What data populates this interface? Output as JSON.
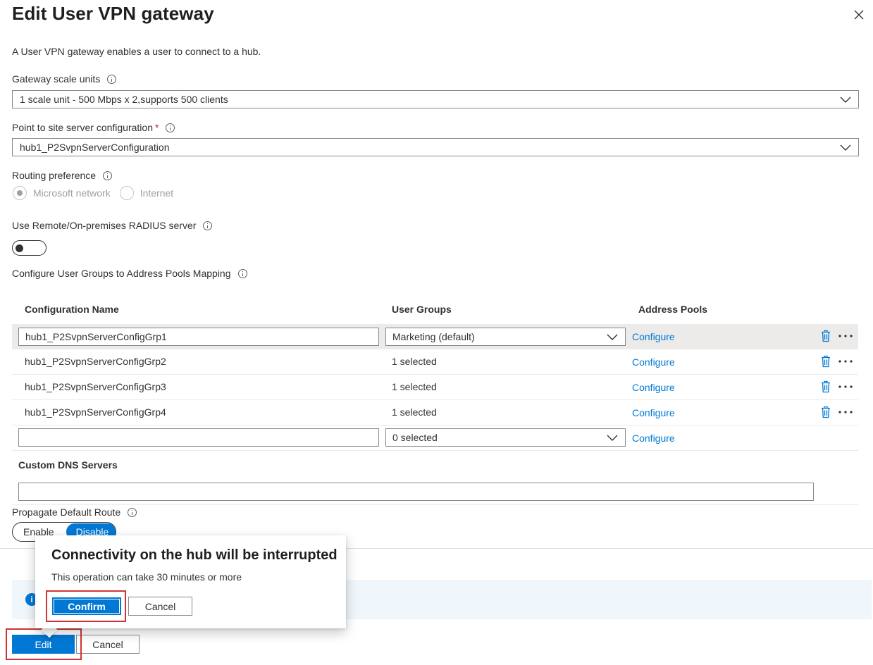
{
  "dialog": {
    "title": "Edit User VPN gateway",
    "description": "A User VPN gateway enables a user to connect to a hub."
  },
  "fields": {
    "gateway_scale_units": {
      "label": "Gateway scale units",
      "value": "1 scale unit - 500 Mbps x 2,supports 500 clients"
    },
    "p2s_config": {
      "label": "Point to site server configuration",
      "required_mark": "*",
      "value": "hub1_P2SvpnServerConfiguration"
    },
    "routing_preference": {
      "label": "Routing preference",
      "options": [
        "Microsoft network",
        "Internet"
      ],
      "selected": "Microsoft network"
    },
    "radius": {
      "label": "Use Remote/On-premises RADIUS server",
      "enabled": false
    },
    "mapping": {
      "label": "Configure User Groups to Address Pools Mapping"
    }
  },
  "table": {
    "headers": [
      "Configuration Name",
      "User Groups",
      "Address Pools"
    ],
    "rows": [
      {
        "name": "hub1_P2SvpnServerConfigGrp1",
        "groups": "Marketing (default)",
        "pools": "Configure"
      },
      {
        "name": "hub1_P2SvpnServerConfigGrp2",
        "groups": "1 selected",
        "pools": "Configure"
      },
      {
        "name": "hub1_P2SvpnServerConfigGrp3",
        "groups": "1 selected",
        "pools": "Configure"
      },
      {
        "name": "hub1_P2SvpnServerConfigGrp4",
        "groups": "1 selected",
        "pools": "Configure"
      },
      {
        "name": "",
        "groups": "0 selected",
        "pools": "Configure"
      }
    ]
  },
  "dns": {
    "label": "Custom DNS Servers",
    "value": ""
  },
  "propagate": {
    "label": "Propagate Default Route",
    "options": [
      "Enable",
      "Disable"
    ],
    "selected": "Disable"
  },
  "callout": {
    "title": "Connectivity on the hub will be interrupted",
    "message": "This operation can take 30 minutes or more",
    "confirm_label": "Confirm",
    "cancel_label": "Cancel"
  },
  "footer": {
    "edit_label": "Edit",
    "cancel_label": "Cancel"
  },
  "colors": {
    "accent": "#0078d4",
    "highlight_box": "#d13438"
  }
}
